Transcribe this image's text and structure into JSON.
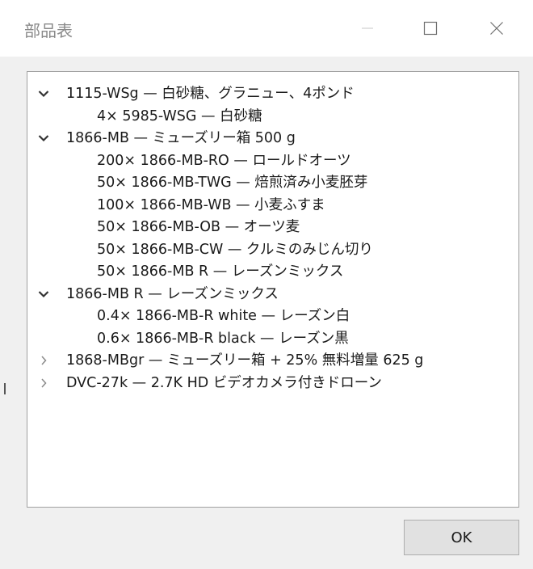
{
  "window": {
    "title": "部品表"
  },
  "tree": {
    "rows": [
      {
        "level": 0,
        "state": "expanded",
        "text": "1115-WSg — 白砂糖、グラニュー、4ポンド"
      },
      {
        "level": 1,
        "text": "4×  5985-WSG — 白砂糖"
      },
      {
        "level": 0,
        "state": "expanded",
        "text": "1866-MB — ミューズリー箱 500 g"
      },
      {
        "level": 1,
        "text": "200×  1866-MB-RO — ロールドオーツ"
      },
      {
        "level": 1,
        "text": "50×  1866-MB-TWG — 焙煎済み小麦胚芽"
      },
      {
        "level": 1,
        "text": "100×  1866-MB-WB — 小麦ふすま"
      },
      {
        "level": 1,
        "text": "50×  1866-MB-OB — オーツ麦"
      },
      {
        "level": 1,
        "text": "50×  1866-MB-CW — クルミのみじん切り"
      },
      {
        "level": 1,
        "text": "50×  1866-MB R — レーズンミックス"
      },
      {
        "level": 0,
        "state": "expanded",
        "text": "1866-MB R — レーズンミックス"
      },
      {
        "level": 1,
        "text": "0.4×  1866-MB-R white — レーズン白"
      },
      {
        "level": 1,
        "text": "0.6×  1866-MB-R black — レーズン黒"
      },
      {
        "level": 0,
        "state": "collapsed",
        "text": "1868-MBgr — ミューズリー箱 + 25% 無料増量 625 g"
      },
      {
        "level": 0,
        "state": "collapsed",
        "text": "DVC-27k — 2.7K HD ビデオカメラ付きドローン"
      }
    ]
  },
  "buttons": {
    "ok_label": "OK"
  },
  "icons": {
    "minimize": "minimize-icon",
    "maximize": "maximize-icon",
    "close": "close-icon",
    "expanded": "chevron-down-icon",
    "collapsed": "chevron-right-icon"
  }
}
